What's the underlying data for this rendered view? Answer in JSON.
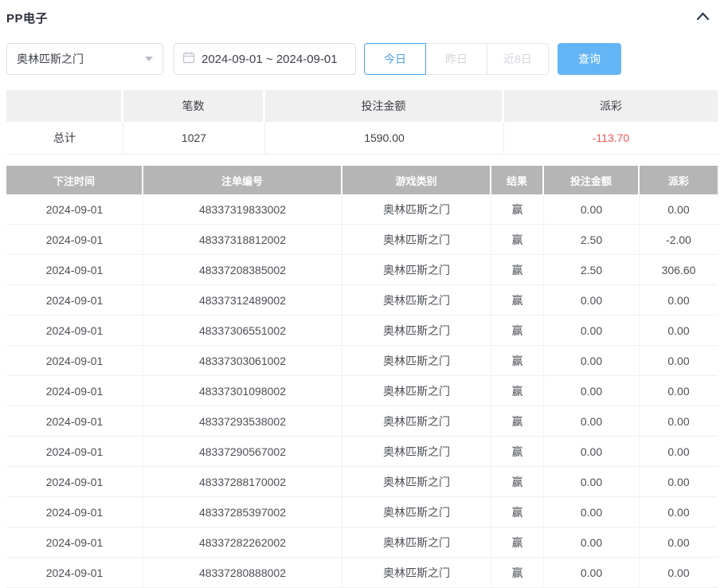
{
  "panel": {
    "title": "PP电子"
  },
  "filters": {
    "game_select": {
      "value": "奥林匹斯之门"
    },
    "date_range": {
      "value": "2024-09-01 ~ 2024-09-01"
    },
    "quick_ranges": [
      {
        "label": "今日",
        "active": true
      },
      {
        "label": "昨日",
        "active": false
      },
      {
        "label": "近8日",
        "active": false
      }
    ],
    "query_label": "查询"
  },
  "summary": {
    "columns": {
      "count": "笔数",
      "bet_amount": "投注金额",
      "payout": "派彩"
    },
    "total": {
      "label": "总计",
      "count": "1027",
      "bet_amount": "1590.00",
      "payout": "-113.70"
    }
  },
  "table": {
    "columns": [
      "下注时间",
      "注单编号",
      "游戏类别",
      "结果",
      "投注金额",
      "派彩"
    ],
    "rows": [
      [
        "2024-09-01",
        "48337319833002",
        "奥林匹斯之门",
        "赢",
        "0.00",
        "0.00"
      ],
      [
        "2024-09-01",
        "48337318812002",
        "奥林匹斯之门",
        "赢",
        "2.50",
        "-2.00"
      ],
      [
        "2024-09-01",
        "48337208385002",
        "奥林匹斯之门",
        "赢",
        "2.50",
        "306.60"
      ],
      [
        "2024-09-01",
        "48337312489002",
        "奥林匹斯之门",
        "赢",
        "0.00",
        "0.00"
      ],
      [
        "2024-09-01",
        "48337306551002",
        "奥林匹斯之门",
        "赢",
        "0.00",
        "0.00"
      ],
      [
        "2024-09-01",
        "48337303061002",
        "奥林匹斯之门",
        "赢",
        "0.00",
        "0.00"
      ],
      [
        "2024-09-01",
        "48337301098002",
        "奥林匹斯之门",
        "赢",
        "0.00",
        "0.00"
      ],
      [
        "2024-09-01",
        "48337293538002",
        "奥林匹斯之门",
        "赢",
        "0.00",
        "0.00"
      ],
      [
        "2024-09-01",
        "48337290567002",
        "奥林匹斯之门",
        "赢",
        "0.00",
        "0.00"
      ],
      [
        "2024-09-01",
        "48337288170002",
        "奥林匹斯之门",
        "赢",
        "0.00",
        "0.00"
      ],
      [
        "2024-09-01",
        "48337285397002",
        "奥林匹斯之门",
        "赢",
        "0.00",
        "0.00"
      ],
      [
        "2024-09-01",
        "48337282262002",
        "奥林匹斯之门",
        "赢",
        "0.00",
        "0.00"
      ],
      [
        "2024-09-01",
        "48337280888002",
        "奥林匹斯之门",
        "赢",
        "0.00",
        "0.00"
      ]
    ]
  },
  "colors": {
    "accent_blue": "#64b5f6",
    "active_range_blue": "#4da3e8",
    "negative_red": "#f25555",
    "table_header_gray": "#b5b5b5"
  }
}
